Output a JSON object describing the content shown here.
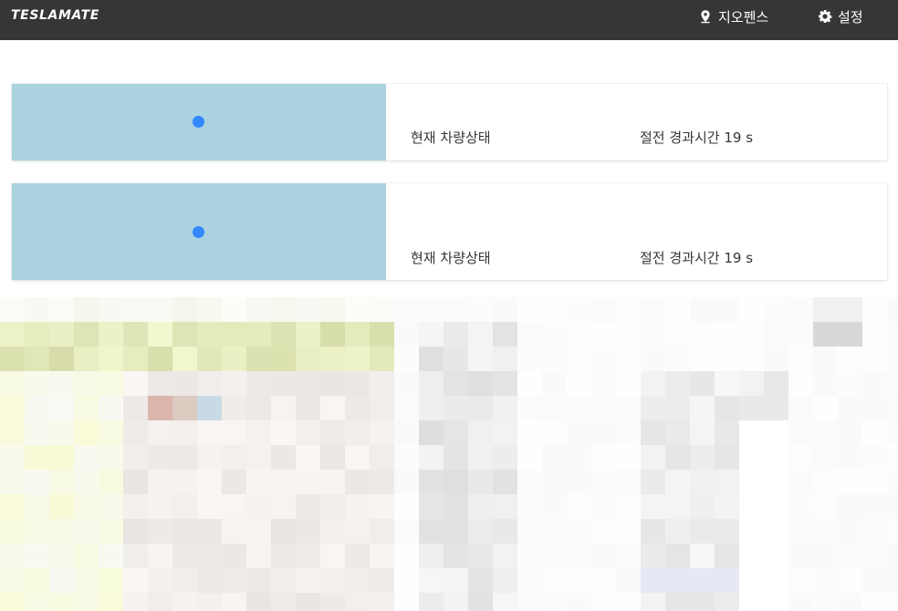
{
  "navbar": {
    "brand": "TESLAMATE",
    "geofence_label": "지오펜스",
    "settings_label": "설정",
    "geofence_icon": "map-marker-icon",
    "settings_icon": "gear-icon",
    "background": "#363636"
  },
  "cars": [
    {
      "state_label": "현재 차량상태",
      "elapsed_label": "절전 경과시간 19 s"
    },
    {
      "state_label": "현재 차량상태",
      "elapsed_label": "절전 경과시간 19 s"
    }
  ],
  "colors": {
    "map_water": "#aad3df",
    "marker": "#3388ff"
  }
}
